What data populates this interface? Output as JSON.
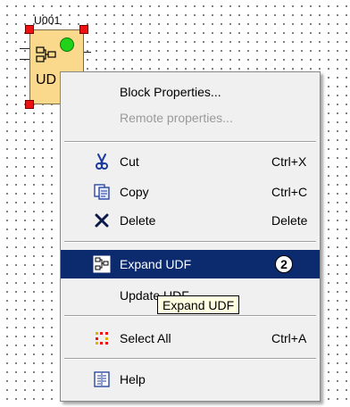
{
  "block": {
    "id_label": "U001",
    "text": "UD",
    "icon": "udf-block-icon"
  },
  "menu": {
    "items": [
      {
        "label": "Block Properties...",
        "shortcut": "",
        "icon": "",
        "enabled": true
      },
      {
        "label": "Remote properties...",
        "shortcut": "",
        "icon": "",
        "enabled": false
      },
      {
        "label": "Cut",
        "shortcut": "Ctrl+X",
        "icon": "scissors-icon",
        "enabled": true
      },
      {
        "label": "Copy",
        "shortcut": "Ctrl+C",
        "icon": "copy-icon",
        "enabled": true
      },
      {
        "label": "Delete",
        "shortcut": "Delete",
        "icon": "delete-x-icon",
        "enabled": true
      },
      {
        "label": "Expand UDF",
        "shortcut": "",
        "icon": "expand-udf-icon",
        "enabled": true,
        "highlighted": true,
        "badge": "2"
      },
      {
        "label": "Update UDF",
        "shortcut": "",
        "icon": "",
        "enabled": true
      },
      {
        "label": "Select All",
        "shortcut": "Ctrl+A",
        "icon": "select-all-icon",
        "enabled": true
      },
      {
        "label": "Help",
        "shortcut": "",
        "icon": "help-icon",
        "enabled": true
      }
    ]
  },
  "tooltip": {
    "text": "Expand UDF"
  },
  "colors": {
    "highlight": "#0c2a6e",
    "block_fill": "#fbd98c",
    "handle": "#e11111",
    "led": "#22d11a",
    "tooltip_bg": "#ffffe1"
  }
}
